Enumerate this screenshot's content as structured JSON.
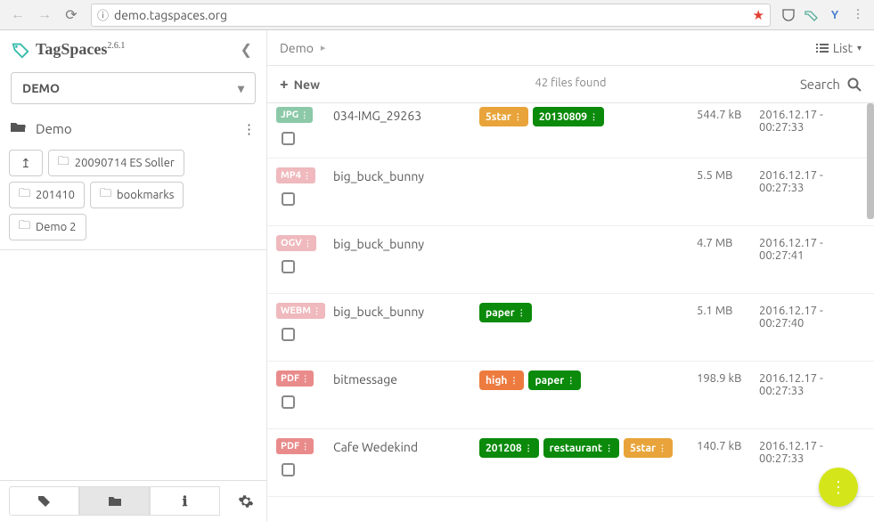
{
  "browser": {
    "url": "demo.tagspaces.org"
  },
  "brand": {
    "name": "TagSpaces",
    "version": "2.6.1"
  },
  "location": {
    "selected": "DEMO"
  },
  "sidebar": {
    "folder": "Demo",
    "chips": [
      "20090714 ES Soller",
      "201410",
      "bookmarks",
      "Demo 2"
    ]
  },
  "header": {
    "crumb": "Demo",
    "view": "List",
    "new_label": "New",
    "count": "42 files found",
    "search": "Search"
  },
  "files": [
    {
      "ext": "JPG",
      "ext_cls": "ext-jpg",
      "name": "034-IMG_29263",
      "tags": [
        {
          "t": "5star",
          "c": "tag-orange"
        },
        {
          "t": "20130809",
          "c": "tag-green"
        }
      ],
      "size": "544.7 kB",
      "date": "2016.12.17 - 00:27:33"
    },
    {
      "ext": "MP4",
      "ext_cls": "ext-mp4",
      "name": "big_buck_bunny",
      "tags": [],
      "size": "5.5 MB",
      "date": "2016.12.17 - 00:27:33"
    },
    {
      "ext": "OGV",
      "ext_cls": "ext-ogv",
      "name": "big_buck_bunny",
      "tags": [],
      "size": "4.7 MB",
      "date": "2016.12.17 - 00:27:41"
    },
    {
      "ext": "WEBM",
      "ext_cls": "ext-webm",
      "name": "big_buck_bunny",
      "tags": [
        {
          "t": "paper",
          "c": "tag-green"
        }
      ],
      "size": "5.1 MB",
      "date": "2016.12.17 - 00:27:40"
    },
    {
      "ext": "PDF",
      "ext_cls": "ext-pdf",
      "name": "bitmessage",
      "tags": [
        {
          "t": "high",
          "c": "tag-orange2"
        },
        {
          "t": "paper",
          "c": "tag-green"
        }
      ],
      "size": "198.9 kB",
      "date": "2016.12.17 - 00:27:33"
    },
    {
      "ext": "PDF",
      "ext_cls": "ext-pdf",
      "name": "Cafe Wedekind",
      "tags": [
        {
          "t": "201208",
          "c": "tag-green"
        },
        {
          "t": "restaurant",
          "c": "tag-green"
        },
        {
          "t": "5star",
          "c": "tag-orange"
        }
      ],
      "size": "140.7 kB",
      "date": "2016.12.17 - 00:27:33"
    }
  ]
}
